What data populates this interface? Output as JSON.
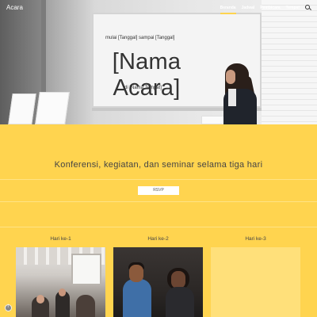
{
  "header": {
    "site_title": "Acara",
    "nav": [
      {
        "label": "Beranda",
        "active": true
      },
      {
        "label": "Jadwal",
        "active": false
      },
      {
        "label": "Pembicara",
        "active": false
      },
      {
        "label": "Tempat",
        "active": false
      }
    ],
    "search_icon": "search-icon"
  },
  "hero": {
    "dates": "mulai [Tanggal] sampai [Tanggal]",
    "title": "[Nama Acara]",
    "place": "di [Nama Tempat]"
  },
  "main": {
    "tagline": "Konferensi, kegiatan, dan seminar selama tiga hari",
    "rsvp_label": "RSVP",
    "days": [
      {
        "label": "Hari ke-1"
      },
      {
        "label": "Hari ke-2"
      },
      {
        "label": "Hari ke-3"
      }
    ]
  },
  "colors": {
    "accent": "#ffd44f",
    "text": "#444444"
  },
  "footer": {
    "info_icon": "info-icon"
  }
}
